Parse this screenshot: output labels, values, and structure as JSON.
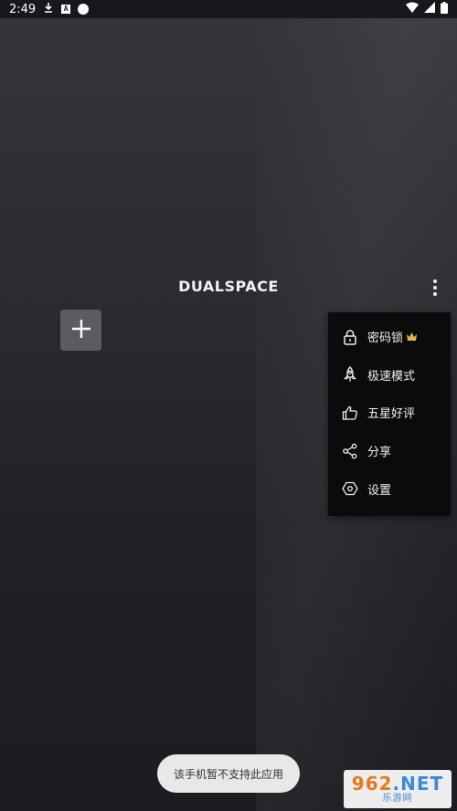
{
  "status_bar": {
    "time": "2:49",
    "icons": [
      "download-icon",
      "a-badge-icon",
      "circle-icon",
      "wifi-icon",
      "signal-icon",
      "battery-icon"
    ]
  },
  "app": {
    "logo_text": "DUALSPACE",
    "more_icon": "more-vertical-icon",
    "add_icon": "plus-icon"
  },
  "menu": {
    "items": [
      {
        "label": "密码锁",
        "icon": "lock-icon",
        "badge": "crown-icon"
      },
      {
        "label": "极速模式",
        "icon": "rocket-icon"
      },
      {
        "label": "五星好评",
        "icon": "thumbs-up-icon"
      },
      {
        "label": "分享",
        "icon": "share-icon"
      },
      {
        "label": "设置",
        "icon": "settings-icon"
      }
    ]
  },
  "toast": {
    "text": "该手机暂不支持此应用"
  },
  "watermark": {
    "top": "962",
    "top_suffix": ".NET",
    "bottom": "乐游网"
  },
  "colors": {
    "background": "#2a2c31",
    "menu_bg": "#0b0b0c",
    "crown": "#e0b34a",
    "add_button_bg": "#5a5c61"
  }
}
